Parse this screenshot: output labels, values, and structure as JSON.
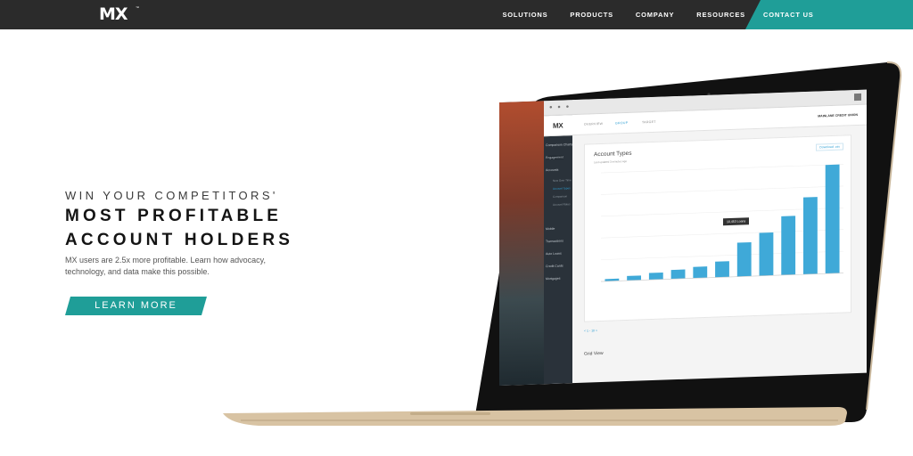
{
  "nav": {
    "logo": "MX",
    "logo_tm": "™",
    "links": [
      "SOLUTIONS",
      "PRODUCTS",
      "COMPANY",
      "RESOURCES"
    ],
    "cta": "CONTACT US"
  },
  "hero": {
    "eyebrow": "WIN YOUR COMPETITORS'",
    "headline_line1": "MOST PROFITABLE",
    "headline_line2": "ACCOUNT HOLDERS",
    "subtext": "MX users are 2.5x more profitable. Learn how advocacy, technology, and data make this possible.",
    "button": "LEARN MORE"
  },
  "screen": {
    "logo": "MX",
    "tabs": [
      "OVERVIEW",
      "GROUP",
      "TARGET"
    ],
    "active_tab": "GROUP",
    "org_name": "MAINLANE CREDIT UNION",
    "sidebar": {
      "items": [
        "Comparison Charts",
        "Engagement",
        "Accounts",
        "Mobile",
        "Transactions",
        "Auto Loans",
        "Credit Cards",
        "Mortgages"
      ],
      "subitems": [
        "New Over Time",
        "Account Types",
        "Comparison",
        "Account Rates"
      ],
      "active_subitem": "Account Types"
    },
    "card": {
      "title": "Account Types",
      "subtitle": "Last updated 3 minutes ago",
      "download": "Download .csv"
    },
    "tooltip": "10,453 Loans",
    "pager": "< 1 - 10 >",
    "grid_view": "Grid View",
    "accent": "#2d9ed3",
    "bars_color": "#3fa9d8"
  },
  "chart_data": {
    "type": "bar",
    "values": [
      2,
      4,
      6,
      8,
      10,
      14,
      30,
      38,
      52,
      68,
      96
    ]
  },
  "colors": {
    "nav_bg": "#2b2b2b",
    "brand_teal": "#1f9e98",
    "headline": "#141414"
  }
}
